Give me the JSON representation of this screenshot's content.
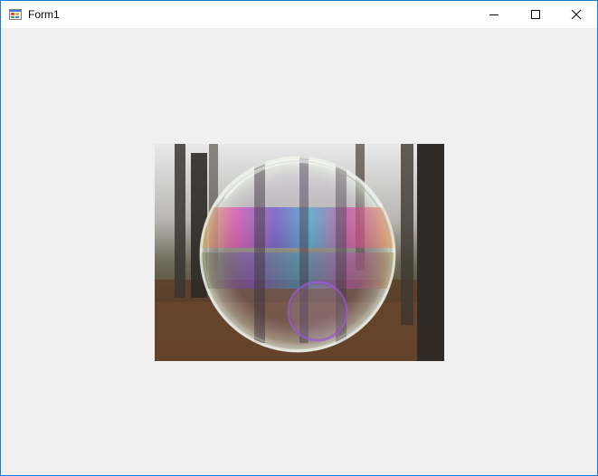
{
  "window": {
    "title": "Form1",
    "icon": "windows-forms-app-icon",
    "border_color": "#1a7ed4",
    "client_background": "#f0f0f0"
  },
  "caption_buttons": {
    "minimize_icon": "minimize-icon",
    "maximize_icon": "maximize-icon",
    "close_icon": "close-icon"
  },
  "picture_box": {
    "content": "soap-bubble-photo"
  }
}
